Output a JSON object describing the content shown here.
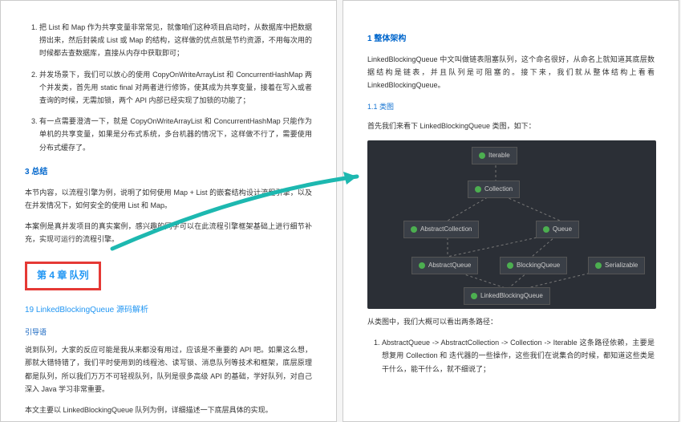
{
  "left": {
    "items": [
      "把 List 和 Map 作为共享变量非常常见，就像咱们这种项目启动时，从数据库中把数据捞出来，然后封装成 List 或 Map 的结构，这样做的优点就是节约资源，不用每次用的时候都去查数据库，直接从内存中获取即可；",
      "并发场景下，我们可以放心的使用 CopyOnWriteArrayList 和 ConcurrentHashMap 两个并发类，首先用 static final 对两者进行修饰，使其成为共享变量，接着在写入或者查询的时候，无需加锁，两个 API 内部已经实现了加锁的功能了；",
      "有一点需要澄清一下，就是 CopyOnWriteArrayList 和 ConcurrentHashMap 只能作为单机的共享变量，如果是分布式系统，多台机器的情况下，这样做不行了，需要使用分布式缓存了。"
    ],
    "h_summary": "3 总结",
    "p1": "本节内容，以流程引擎为例，说明了如何使用 Map + List 的嵌套结构设计流程引擎，以及在并发情况下，如何安全的使用 List 和 Map。",
    "p2": "本案例是真并发项目的真实案例，感兴趣的同学可以在此流程引擎框架基础上进行细节补充，实现可运行的流程引擎。",
    "chapter": "第 4 章 队列",
    "chapter_sub": "19 LinkedBlockingQueue 源码解析",
    "h_intro": "引导语",
    "p3": "说到队列，大家的反应可能是我从来都没有用过，应该是不重要的 API 吧。如果这么想，那就大错特错了，我们平时使用到的线程池、读写锁、消息队列等技术和框架，底层原理都是队列，所以我们万万不可轻视队列，队列是很多高级 API 的基础，学好队列，对自己深入 Java 学习非常重要。",
    "p4": "本文主要以 LinkedBlockingQueue 队列为例，详细描述一下底层具体的实现。"
  },
  "right": {
    "h_arch": "1 整体架构",
    "p1": "LinkedBlockingQueue 中文叫做链表阻塞队列，这个命名很好，从命名上就知道其底层数据结构是链表，并且队列是可阻塞的。接下来，我们就从整体结构上看看 LinkedBlockingQueue。",
    "h_class": "1.1 类图",
    "p2": "首先我们来看下 LinkedBlockingQueue 类图，如下：",
    "nodes": {
      "n1": "Iterable",
      "n2": "Collection",
      "n3": "AbstractCollection",
      "n4": "Queue",
      "n5": "AbstractQueue",
      "n6": "BlockingQueue",
      "n7": "Serializable",
      "n8": "LinkedBlockingQueue"
    },
    "p3": "从类图中，我们大概可以看出两条路径：",
    "li1": "AbstractQueue -> AbstractCollection -> Collection -> Iterable 这条路径依赖，主要是想复用 Collection 和 迭代器的一些操作，这些我们在说集合的时候，都知道这些类是干什么，能干什么，就不细说了；"
  }
}
